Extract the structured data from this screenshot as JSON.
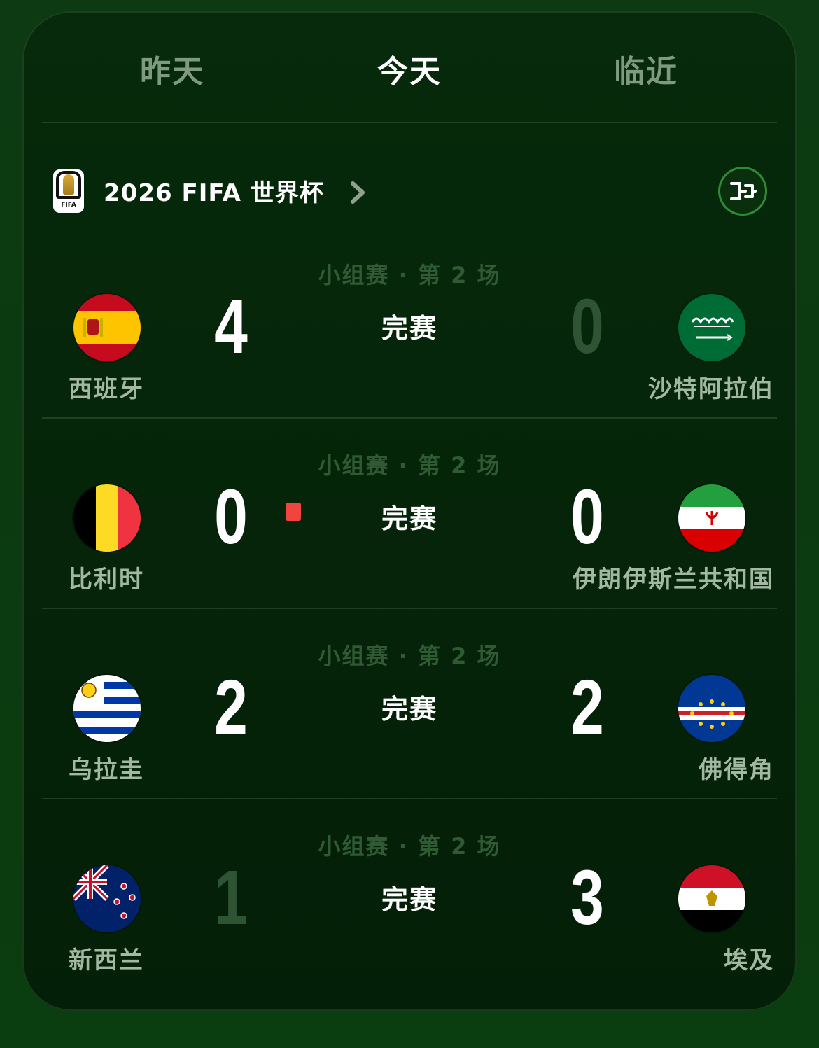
{
  "tabs": {
    "yesterday": "昨天",
    "today": "今天",
    "upcoming": "临近"
  },
  "league": {
    "logo_text": "FIFA",
    "name": "2026 FIFA 世界杯"
  },
  "icons": {
    "league_logo": "fifa-world-cup-logo",
    "chevron": "chevron-right-icon",
    "bracket": "bracket-icon",
    "red_card": "red-card-icon"
  },
  "colors": {
    "active_tab": "#ffffff",
    "inactive_tab": "#7f9a7f",
    "losing_score": "#2e5434",
    "red_card": "#f0453e",
    "accent": "#2f8a3a"
  },
  "matches": [
    {
      "stage": "小组赛 · 第 2 场",
      "home": "西班牙",
      "away": "沙特阿拉伯",
      "home_score": "4",
      "away_score": "0",
      "status": "完赛",
      "home_flag": "spain-flag",
      "away_flag": "saudi-arabia-flag"
    },
    {
      "stage": "小组赛 · 第 2 场",
      "home": "比利时",
      "away": "伊朗伊斯兰共和国",
      "home_score": "0",
      "away_score": "0",
      "status": "完赛",
      "home_flag": "belgium-flag",
      "away_flag": "iran-flag"
    },
    {
      "stage": "小组赛 · 第 2 场",
      "home": "乌拉圭",
      "away": "佛得角",
      "home_score": "2",
      "away_score": "2",
      "status": "完赛",
      "home_flag": "uruguay-flag",
      "away_flag": "cape-verde-flag"
    },
    {
      "stage": "小组赛 · 第 2 场",
      "home": "新西兰",
      "away": "埃及",
      "home_score": "1",
      "away_score": "3",
      "status": "完赛",
      "home_flag": "new-zealand-flag",
      "away_flag": "egypt-flag"
    }
  ]
}
